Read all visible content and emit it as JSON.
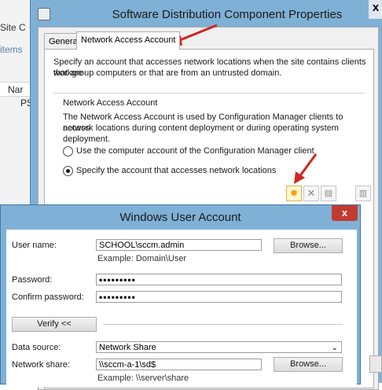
{
  "background": {
    "site_text": "Site C",
    "items_text": "items",
    "col_header": "Nar",
    "row_text": "PSI"
  },
  "sd_dialog": {
    "title": "Software Distribution Component Properties",
    "close_label": "x",
    "tabs": [
      "General",
      "Network Access Account"
    ],
    "intro_line1": "Specify an account that accesses network locations when the site contains clients that are",
    "intro_line2": "workgroup computers or that are from an untrusted domain.",
    "group_title": "Network Access Account",
    "group_desc1": "The Network Access Account is used by Configuration Manager clients to access",
    "group_desc2": "network locations during content deployment or during operating system deployment.",
    "radio1_label": "Use the computer account of the Configuration Manager client",
    "radio2_label": "Specify the account that accesses network locations",
    "radio_selected": 2,
    "toolbar_icons": [
      "new-account-icon",
      "delete-icon",
      "properties-icon",
      "copy-icon"
    ],
    "toolbar_glyphs": [
      "✹",
      "✕",
      "▤",
      "▥"
    ],
    "accent_color": "#f3a20f"
  },
  "wua_dialog": {
    "title": "Windows User Account",
    "close_label": "x",
    "username_label": "User name:",
    "username_value": "SCHOOL\\sccm.admin",
    "username_example": "Example: Domain\\User",
    "browse_label": "Browse...",
    "password_label": "Password:",
    "password_value": "•••••••••",
    "confirm_label": "Confirm password:",
    "confirm_value": "•••••••••",
    "verify_label": "Verify <<",
    "datasource_label": "Data source:",
    "datasource_value": "Network Share",
    "networkshare_label": "Network share:",
    "networkshare_value": "\\\\sccm-a-1\\sd$",
    "networkshare_browse": "Browse...",
    "networkshare_example": "Example: \\\\server\\share"
  }
}
